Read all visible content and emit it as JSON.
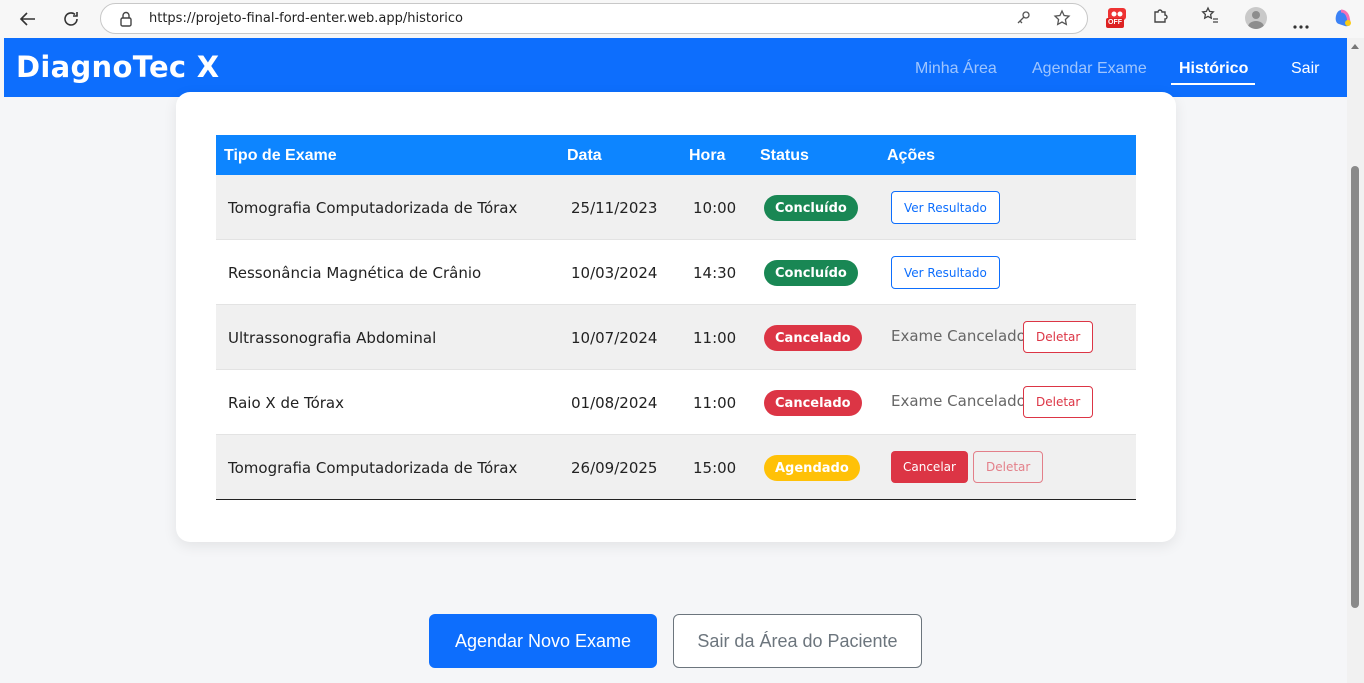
{
  "browser": {
    "url": "https://projeto-final-ford-enter.web.app/historico",
    "ext_badge": "OFF"
  },
  "header": {
    "brand": "DiagnoTec X",
    "nav": [
      {
        "label": "Minha Área"
      },
      {
        "label": "Agendar Exame"
      },
      {
        "label": "Histórico",
        "active": true
      },
      {
        "label": "Sair"
      }
    ]
  },
  "table": {
    "columns": [
      "Tipo de Exame",
      "Data",
      "Hora",
      "Status",
      "Ações"
    ],
    "rows": [
      {
        "exam": "Tomografia Computadorizada de Tórax",
        "date": "25/11/2023",
        "time": "10:00",
        "status": "Concluído",
        "action": "Ver Resultado"
      },
      {
        "exam": "Ressonância Magnética de Crânio",
        "date": "10/03/2024",
        "time": "14:30",
        "status": "Concluído",
        "action": "Ver Resultado"
      },
      {
        "exam": "Ultrassonografia Abdominal",
        "date": "10/07/2024",
        "time": "11:00",
        "status": "Cancelado",
        "note": "Exame Cancelado",
        "action": "Deletar"
      },
      {
        "exam": "Raio X de Tórax",
        "date": "01/08/2024",
        "time": "11:00",
        "status": "Cancelado",
        "note": "Exame Cancelado",
        "action": "Deletar"
      },
      {
        "exam": "Tomografia Computadorizada de Tórax",
        "date": "26/09/2025",
        "time": "15:00",
        "status": "Agendado",
        "action": "Cancelar",
        "action2": "Deletar"
      }
    ]
  },
  "footer_buttons": {
    "primary": "Agendar Novo Exame",
    "secondary": "Sair da Área do Paciente"
  },
  "colors": {
    "primary": "#0d6efd",
    "success": "#198754",
    "danger": "#dc3545",
    "warning": "#ffc107"
  }
}
